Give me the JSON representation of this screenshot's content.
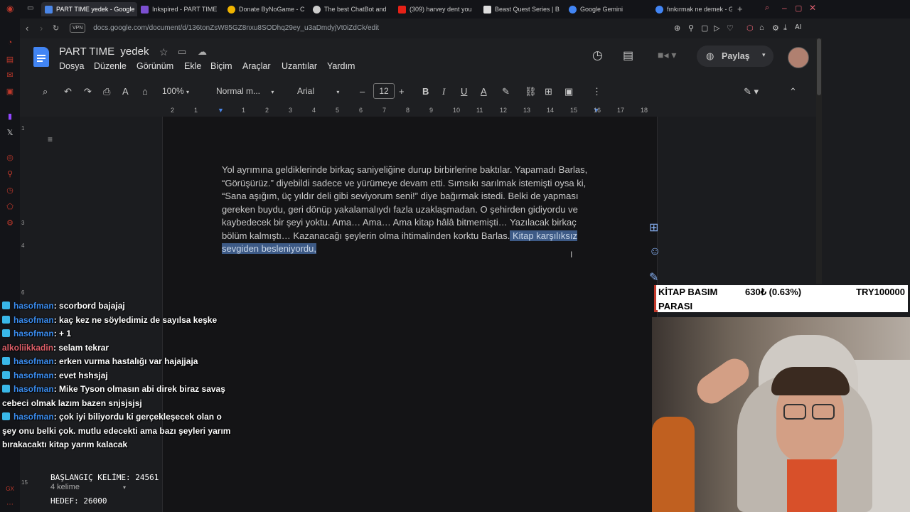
{
  "browser": {
    "tabs": [
      {
        "title": "PART TIME yedek - Google",
        "active": true
      },
      {
        "title": "Inkspired - PART TIME"
      },
      {
        "title": "Donate ByNoGame - C"
      },
      {
        "title": "The best ChatBot and"
      },
      {
        "title": "(309) harvey dent you"
      },
      {
        "title": "Beast Quest Series | B"
      },
      {
        "title": "Google Gemini"
      },
      {
        "title": "fınkırmak ne demek - G"
      }
    ],
    "vpn_label": "VPN",
    "url": "docs.google.com/document/d/136tonZsW85GZ8nxu8SODhq29ey_u3aDmdyjVt0iZdCk/edit",
    "ai_label": "AI"
  },
  "docs": {
    "title": "PART TIME  yedek",
    "menu": [
      "Dosya",
      "Düzenle",
      "Görünüm",
      "Ekle",
      "Biçim",
      "Araçlar",
      "Uzantılar",
      "Yardım"
    ],
    "share_label": "Paylaş",
    "toolbar": {
      "zoom": "100%",
      "style": "Normal m...",
      "font": "Arial",
      "font_size": "12"
    },
    "ruler_ticks": [
      "2",
      "1",
      "1",
      "2",
      "3",
      "4",
      "5",
      "6",
      "7",
      "8",
      "9",
      "10",
      "11",
      "12",
      "13",
      "14",
      "15",
      "16",
      "17",
      "18"
    ],
    "paragraph": "Yol ayrımına geldiklerinde birkaç saniyeliğine durup birbirlerine baktılar. Yapamadı Barlas, “Görüşürüz.” diyebildi sadece ve yürümeye devam etti. Sımsıkı sarılmak istemişti oysa ki, “Sana aşığım, üç yıldır deli gibi seviyorum seni!” diye bağırmak istedi. Belki de yapması gereken buydu, geri dönüp yakalamalıydı fazla uzaklaşmadan. O şehirden gidiyordu ve kaybedecek bir şeyi yoktu. Ama… Ama… Ama kitap hâlâ bitmemişti… Yazılacak birkaç bölüm kalmıştı… Kazanacağı şeylerin olma ihtimalinden korktu Barlas.",
    "selected_text": " Kitap karşılıksız sevgiden besleniyordu, ",
    "word_count": "4 kelime"
  },
  "chat": [
    {
      "user": "hasofman",
      "text": ": scorbord bajajaj",
      "badge": true
    },
    {
      "user": "hasofman",
      "text": ": kaç kez ne söyledimiz de sayılsa keşke",
      "badge": true
    },
    {
      "user": "hasofman",
      "text": ": + 1",
      "badge": true
    },
    {
      "user": "alkoliikkadin",
      "text": ": selam tekrar",
      "badge": false
    },
    {
      "user": "hasofman",
      "text": ": erken vurma hastalığı var hajajjaja",
      "badge": true
    },
    {
      "user": "hasofman",
      "text": ": evet hshsjaj",
      "badge": true
    },
    {
      "user": "hasofman",
      "text": ": Mike Tyson olmasın abi direk biraz savaş cebeci olmak lazım bazen snjsjsjsj",
      "badge": true
    },
    {
      "user": "hasofman",
      "text": ": çok iyi biliyordu ki gerçekleşecek olan o şey onu belki çok. mutlu edecekti ama bazı şeyleri yarım bırakacaktı kitap yarım kalacak",
      "badge": true
    }
  ],
  "counter": {
    "start": "BAŞLANGIÇ KELİME: 24561",
    "target": "HEDEF: 26000"
  },
  "donation": {
    "label_line1": "KİTAP BASIM",
    "label_line2": "PARASI",
    "current": "630₺ (0.63%)",
    "goal": "TRY100000",
    "progress_percent": 0.63
  },
  "colors": {
    "selection": "#3d5a86",
    "chat_user": "#3b8df0",
    "chat_user_alt": "#e0606a",
    "accent_red": "#c0392b"
  }
}
